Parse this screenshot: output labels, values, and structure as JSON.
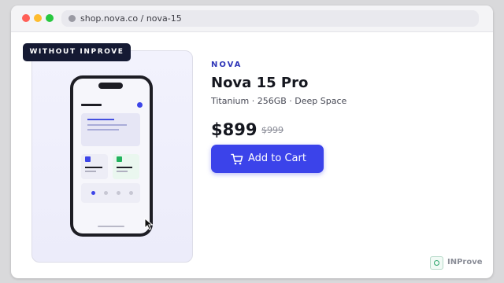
{
  "browser": {
    "url": "shop.nova.co / nova-15"
  },
  "badge": {
    "label": "WITHOUT INPROVE"
  },
  "product": {
    "brand": "NOVA",
    "title": "Nova 15 Pro",
    "variant": "Titanium · 256GB · Deep Space",
    "price": "$899",
    "original_price": "$999",
    "add_to_cart_label": "Add to Cart",
    "image_icon": "smartphone-illustration"
  },
  "watermark": {
    "text": "INProve",
    "icon": "inprove-logo-icon"
  },
  "colors": {
    "accent": "#3b43ea",
    "brand_text": "#2f36b8",
    "badge_bg": "#151a33",
    "card_bg": "#f2f2fd"
  }
}
